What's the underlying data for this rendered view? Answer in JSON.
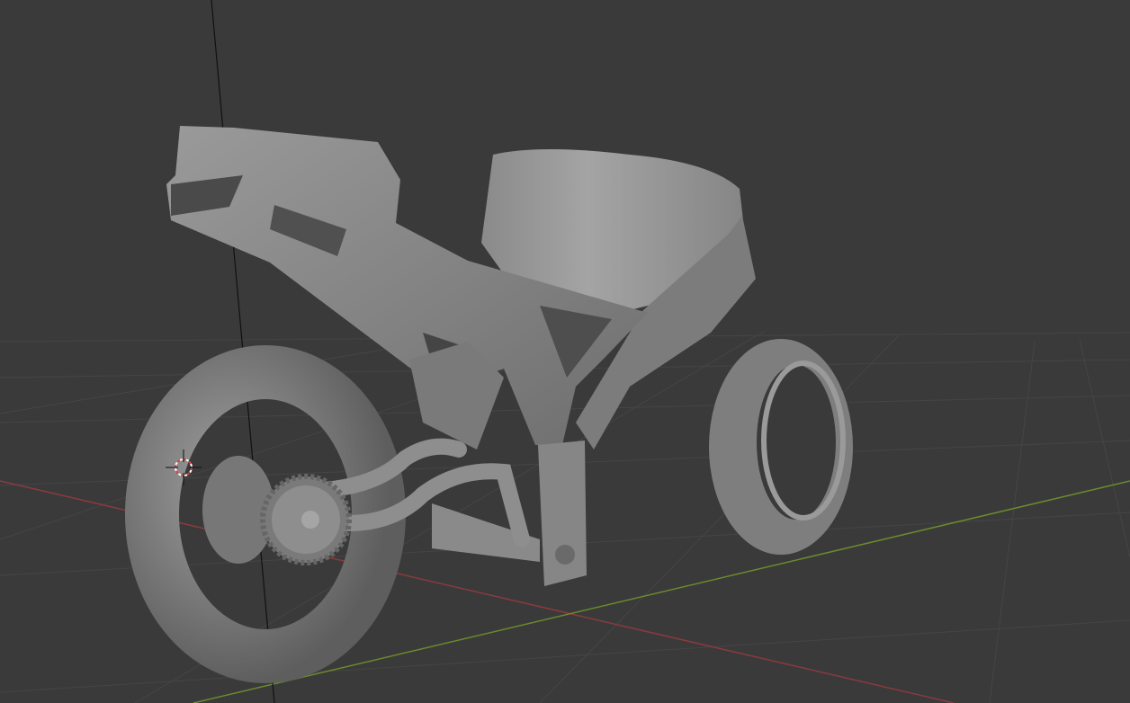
{
  "viewport": {
    "mode": "3D Viewport",
    "background_color": "#3a3a3a",
    "grid_color": "#444444",
    "x_axis_color": "#8a3a3f",
    "y_axis_color": "#6b8a2e",
    "z_axis_color": "#111111",
    "model_color": "#8c8c8c"
  },
  "icons": {
    "cursor": "3d-cursor-icon"
  }
}
